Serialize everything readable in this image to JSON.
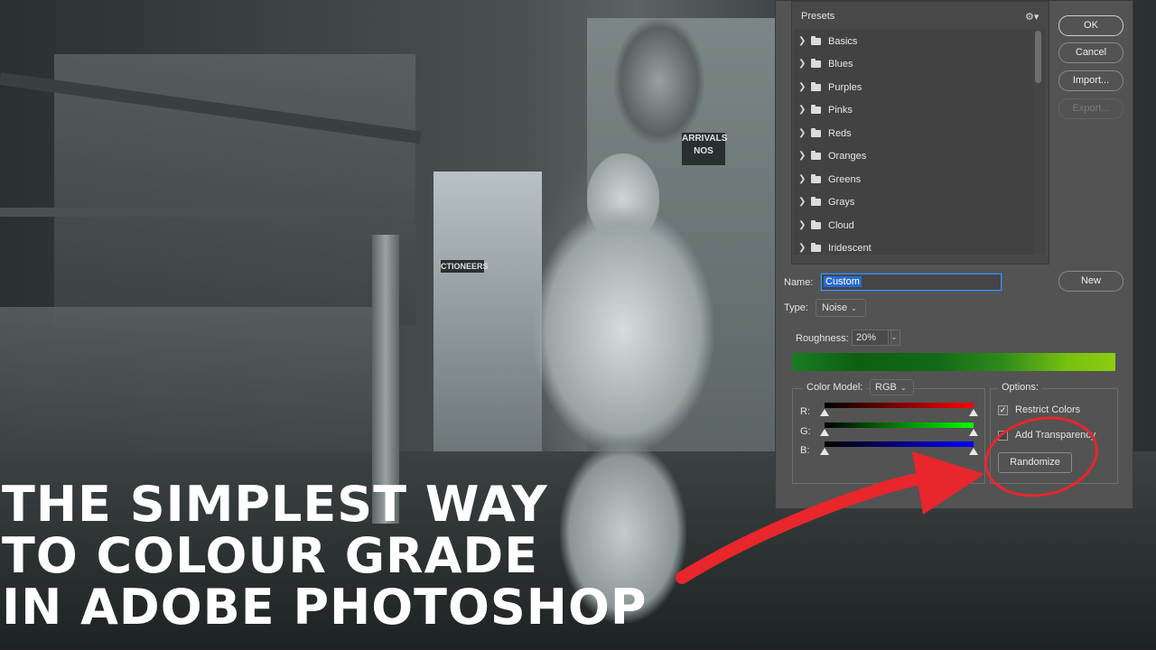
{
  "photo": {
    "sign_text": "ARRIVALS NOS",
    "sign2_text": "CTIONEERS"
  },
  "headline": {
    "line1": "THE SIMPLEST WAY",
    "line2": "TO COLOUR GRADE",
    "line3": "IN ADOBE PHOTOSHOP"
  },
  "dialog": {
    "presets_title": "Presets",
    "presets_settings_icon": "gear-icon",
    "presets": [
      {
        "label": "Basics"
      },
      {
        "label": "Blues"
      },
      {
        "label": "Purples"
      },
      {
        "label": "Pinks"
      },
      {
        "label": "Reds"
      },
      {
        "label": "Oranges"
      },
      {
        "label": "Greens"
      },
      {
        "label": "Grays"
      },
      {
        "label": "Cloud"
      },
      {
        "label": "Iridescent"
      }
    ],
    "buttons": {
      "ok": "OK",
      "cancel": "Cancel",
      "import": "Import...",
      "export": "Export...",
      "new": "New",
      "randomize": "Randomize"
    },
    "name_label": "Name:",
    "name_value": "Custom",
    "type_label": "Type:",
    "type_value": "Noise",
    "roughness_label": "Roughness:",
    "roughness_value": "20%",
    "color_model_label": "Color Model:",
    "color_model_value": "RGB",
    "channels": [
      {
        "label": "R:",
        "color_end": "#ff0000"
      },
      {
        "label": "G:",
        "color_end": "#00ff00"
      },
      {
        "label": "B:",
        "color_end": "#0000ff"
      }
    ],
    "options_label": "Options:",
    "restrict_colors_label": "Restrict Colors",
    "restrict_colors_checked": true,
    "add_transparency_label": "Add Transparency",
    "add_transparency_checked": false
  },
  "colors": {
    "annotation_red": "#e8262b",
    "dialog_bg": "#535353"
  }
}
